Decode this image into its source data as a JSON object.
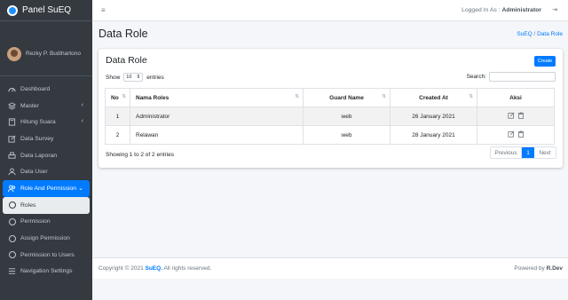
{
  "app": {
    "brand": "Panel SuEQ"
  },
  "user": {
    "name": "Rezky P. Budihartono"
  },
  "sidebar": {
    "items": [
      {
        "label": "Dashboard",
        "icon": "dashboard-icon"
      },
      {
        "label": "Master",
        "icon": "layers-icon",
        "arrow": "‹"
      },
      {
        "label": "Hitung Suara",
        "icon": "calculator-icon",
        "arrow": "‹"
      },
      {
        "label": "Data Survey",
        "icon": "edit-icon"
      },
      {
        "label": "Data Laporan",
        "icon": "printer-icon"
      },
      {
        "label": "Data User",
        "icon": "user-icon"
      },
      {
        "label": "Role And Permission",
        "icon": "users-icon",
        "arrow": "⌄"
      },
      {
        "label": "Roles",
        "icon": "circle-icon"
      },
      {
        "label": "Permission",
        "icon": "circle-icon"
      },
      {
        "label": "Assign Permission",
        "icon": "circle-icon"
      },
      {
        "label": "Permission to Users",
        "icon": "circle-icon"
      },
      {
        "label": "Navigation Settings",
        "icon": "list-icon"
      }
    ]
  },
  "topbar": {
    "menu_icon": "≡",
    "logged_prefix": "Logged In As :",
    "logged_user": "Administrator",
    "logout_icon": "⇥"
  },
  "header": {
    "title": "Data Role",
    "breadcrumb_home": "SuEQ",
    "breadcrumb_sep": "/",
    "breadcrumb_current": "Data Role"
  },
  "card": {
    "title": "Data Role",
    "create_label": "Create",
    "show_label": "Show",
    "entries_value": "10",
    "entries_label": "entries",
    "search_label": "Search:",
    "search_value": ""
  },
  "table": {
    "headers": [
      "No",
      "Nama Roles",
      "Guard Name",
      "Created At",
      "Aksi"
    ],
    "rows": [
      {
        "no": "1",
        "name": "Administrator",
        "guard": "web",
        "created": "26 January 2021"
      },
      {
        "no": "2",
        "name": "Relawan",
        "guard": "web",
        "created": "28 January 2021"
      }
    ]
  },
  "pagination": {
    "info": "Showing 1 to 2 of 2 entries",
    "prev": "Previous",
    "page": "1",
    "next": "Next"
  },
  "footer": {
    "copyright": "Copyright © 2021",
    "brand": "SuEQ.",
    "rights": "All rights reserved.",
    "powered": "Powered by",
    "author": "R.Dev"
  },
  "colors": {
    "accent": "#007bff",
    "sidebar": "#343a40"
  }
}
